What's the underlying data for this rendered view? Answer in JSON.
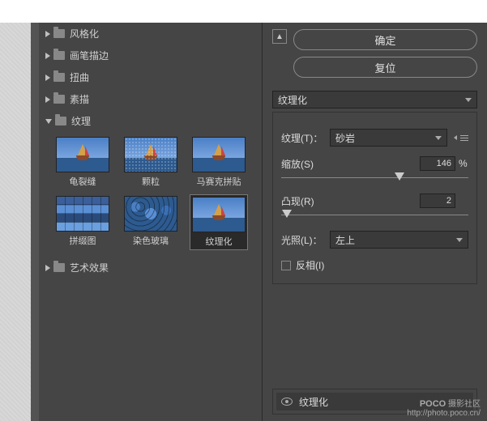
{
  "categories": {
    "stylize": "风格化",
    "brush": "画笔描边",
    "distort": "扭曲",
    "sketch": "素描",
    "texture": "纹理",
    "artistic": "艺术效果"
  },
  "thumbs": {
    "craquelure": "龟裂缝",
    "grain": "颗粒",
    "mosaic": "马赛克拼贴",
    "patchwork": "拼缀图",
    "stained": "染色玻璃",
    "texturizer": "纹理化"
  },
  "buttons": {
    "ok": "确定",
    "reset": "复位"
  },
  "filter_dropdown": "纹理化",
  "params": {
    "texture_label": "纹理(T)：",
    "texture_value": "砂岩",
    "scale_label": "缩放(S)",
    "scale_value": "146",
    "scale_pct": "%",
    "relief_label": "凸现(R)",
    "relief_value": "2",
    "light_label": "光照(L)：",
    "light_value": "左上",
    "invert_label": "反相(I)"
  },
  "slider": {
    "scale_pos": "63%",
    "relief_pos": "3%"
  },
  "layer": {
    "name": "纹理化"
  },
  "watermark": {
    "brand": "POCO",
    "sub": "摄影社区",
    "url": "http://photo.poco.cn/"
  }
}
